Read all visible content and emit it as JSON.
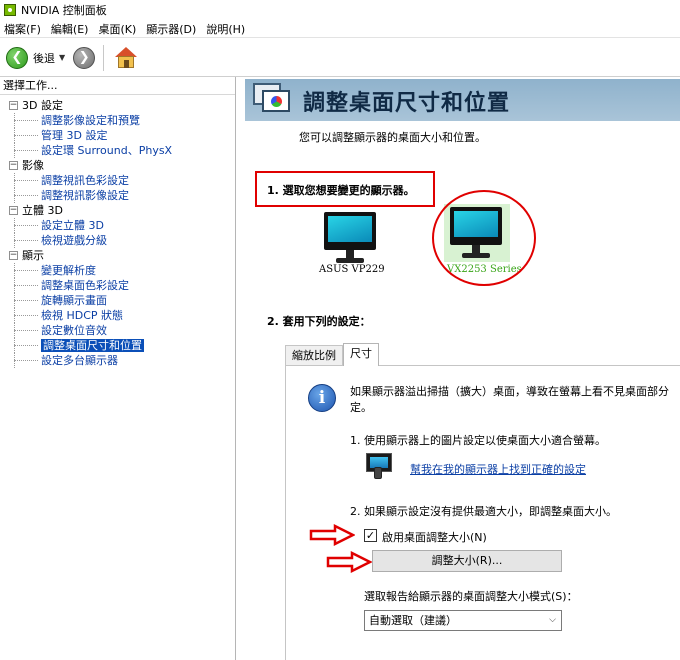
{
  "window": {
    "title": "NVIDIA 控制面板"
  },
  "menu": {
    "items": [
      "檔案(F)",
      "編輯(E)",
      "桌面(K)",
      "顯示器(D)",
      "說明(H)"
    ]
  },
  "toolbar": {
    "back_label": "後退"
  },
  "left_pane": {
    "header": "選擇工作...",
    "categories": [
      {
        "label": "3D 設定",
        "items": [
          "調整影像設定和預覽",
          "管理 3D 設定",
          "設定環 Surround、PhysX"
        ]
      },
      {
        "label": "影像",
        "items": [
          "調整視訊色彩設定",
          "調整視訊影像設定"
        ]
      },
      {
        "label": "立體 3D",
        "items": [
          "設定立體 3D",
          "檢視遊戲分級"
        ]
      },
      {
        "label": "顯示",
        "items": [
          "變更解析度",
          "調整桌面色彩設定",
          "旋轉顯示畫面",
          "檢視 HDCP 狀態",
          "設定數位音效",
          "調整桌面尺寸和位置",
          "設定多台顯示器"
        ]
      }
    ],
    "selected": "調整桌面尺寸和位置"
  },
  "page": {
    "title": "調整桌面尺寸和位置",
    "intro": "您可以調整顯示器的桌面大小和位置。",
    "step1": "1. 選取您想要變更的顯示器。",
    "monitors": [
      {
        "label": "ASUS VP229",
        "selected": false
      },
      {
        "label": "VX2253 Series",
        "selected": true
      }
    ],
    "step2": "2. 套用下列的設定：",
    "tabs": [
      "縮放比例",
      "尺寸"
    ],
    "active_tab": "尺寸",
    "info_text": "如果顯示器溢出掃描（擴大）桌面，導致在螢幕上看不見桌面部分定。",
    "sub1": "1. 使用顯示器上的圖片設定以使桌面大小適合螢幕。",
    "help_link": "幫我在我的顯示器上找到正確的設定",
    "sub2": "2. 如果顯示設定沒有提供最適大小，即調整桌面大小。",
    "checkbox_label": "啟用桌面調整大小(N)",
    "checkbox_checked": true,
    "resize_button": "調整大小(R)...",
    "mode_label": "選取報告給顯示器的桌面調整大小模式(S)：",
    "mode_value": "自動選取（建議）"
  },
  "colors": {
    "banner": "#a9c4d8",
    "link": "#0b3fa5",
    "selected_bg": "#0b4fb8",
    "annotation_red": "#e00000",
    "selected_monitor_label": "#3aa51a"
  }
}
